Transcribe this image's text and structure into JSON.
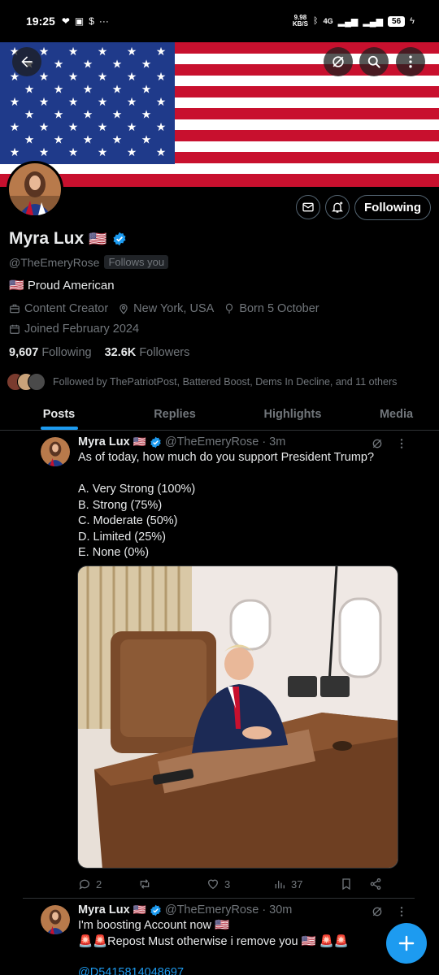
{
  "status_bar": {
    "time": "19:25",
    "net_speed_value": "9.98",
    "net_speed_unit": "KB/S",
    "network": "4G",
    "battery": "56"
  },
  "profile": {
    "name": "Myra Lux",
    "name_flag": "🇺🇸",
    "handle": "@TheEmeryRose",
    "follows_you": "Follows you",
    "bio": "🇺🇸 Proud American",
    "category": "Content Creator",
    "location": "New York, USA",
    "birthday": "Born 5 October",
    "joined": "Joined February 2024",
    "following_count": "9,607",
    "following_label": "Following",
    "followers_count": "32.6K",
    "followers_label": "Followers",
    "followed_by": "Followed by ThePatriotPost, Battered Boost, Dems In Decline, and 11 others",
    "follow_button": "Following"
  },
  "tabs": [
    "Posts",
    "Replies",
    "Highlights",
    "Media"
  ],
  "posts": [
    {
      "name": "Myra Lux",
      "flag": "🇺🇸",
      "handle": "@TheEmeryRose",
      "time": "· 3m",
      "text": "As of today, how much do you support President Trump?\n\nA. Very Strong (100%)\nB. Strong (75%)\nC. Moderate (50%)\nD. Limited (25%)\nE. None (0%)",
      "replies": "2",
      "likes": "3",
      "views": "37"
    },
    {
      "name": "Myra Lux",
      "flag": "🇺🇸",
      "handle": "@TheEmeryRose",
      "time": "· 30m",
      "text": "I'm boosting  Account now 🇺🇸\n🚨🚨Repost Must otherwise i remove you 🇺🇸 🚨🚨",
      "mention": "@D5415814048697"
    }
  ],
  "colors": {
    "accent": "#1d9bf0",
    "background": "#000000",
    "muted_text": "#71767b",
    "divider": "#2f3336"
  },
  "icons": {
    "back": "arrow-left-icon",
    "grok": "grok-icon",
    "search": "search-icon",
    "more": "more-vertical-icon",
    "message": "envelope-icon",
    "notify": "bell-plus-icon",
    "compose": "plus-icon"
  }
}
